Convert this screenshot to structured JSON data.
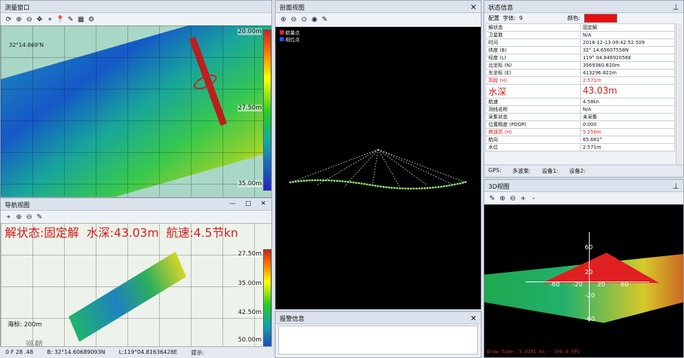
{
  "survey": {
    "title": "测量窗口",
    "coord": "32°14.669'N",
    "depth_ticks": [
      "20.00m",
      "27.50m",
      "35.00m"
    ]
  },
  "nav": {
    "title": "导航视图",
    "status": "解状态:固定解",
    "depth": "水深:43.03m",
    "speed": "航速:4.5节kn",
    "scale": "海标: 200m",
    "ticks": [
      "27.50m",
      "35.00m",
      "42.50m",
      "50.00m"
    ],
    "win_btns": [
      "—",
      "□",
      "✕"
    ]
  },
  "section": {
    "title": "剖面视图",
    "legend": [
      "航量点",
      "相位点"
    ],
    "legend_colors": [
      "#ff2020",
      "#2a4dff"
    ]
  },
  "alarm": {
    "title": "报警信息"
  },
  "state": {
    "title": "状态信息",
    "config_label": "配置",
    "font_label": "字体:",
    "font_value": "9",
    "color_label": "颜色:",
    "color_value": "#e41010",
    "rows": [
      [
        "解状态",
        "固定解"
      ],
      [
        "卫星数",
        "N/A"
      ],
      [
        "时间",
        "2018-12-13 09:42:52.509"
      ],
      [
        "纬度 (B)",
        "32° 14.65607558N"
      ],
      [
        "经度 (L)",
        "119° 04.84692056E"
      ],
      [
        "北坐标 (N)",
        "3569360.820m"
      ],
      [
        "东坐标 (E)",
        "413296.822m"
      ],
      [
        "高程 (H)",
        "2.571m"
      ],
      [
        "水深",
        "43.03m"
      ],
      [
        "航速",
        "4.58kn"
      ],
      [
        "测线名称",
        "N/A"
      ],
      [
        "采集状态",
        "未采集"
      ],
      [
        "位置精度 (PDOP)",
        "0.000"
      ],
      [
        "椭球高 (H)",
        "5.256m"
      ],
      [
        "航向",
        "65.681°"
      ],
      [
        "水位",
        "2.571m"
      ]
    ],
    "gps": [
      "GPS:",
      "多波束:",
      "设备1:",
      "设备2:"
    ]
  },
  "view3d": {
    "title": "3D视图",
    "axes": [
      "60",
      "-60",
      "-20",
      "20",
      "60",
      "20",
      "-20",
      "-60"
    ],
    "footer": "Draw Time: 5.0281 ms - 196.0 FPS"
  },
  "statusbar": {
    "a": "0 F 28 .48",
    "b": "B: 32°14.60689093N",
    "c": "L:119°04.81636428E",
    "d": "提示:"
  },
  "watermark": "巡航"
}
